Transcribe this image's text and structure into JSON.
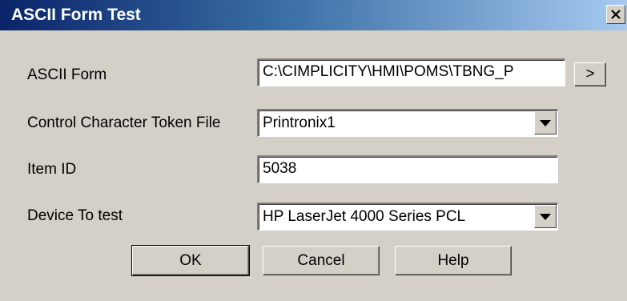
{
  "window": {
    "title": "ASCII Form Test"
  },
  "form": {
    "ascii_form": {
      "label": "ASCII Form",
      "value": "C:\\CIMPLICITY\\HMI\\POMS\\TBNG_P",
      "browse_label": ">"
    },
    "token_file": {
      "label": "Control Character Token File",
      "value": "Printronix1"
    },
    "item_id": {
      "label": "Item ID",
      "value": "5038"
    },
    "device": {
      "label": "Device To test",
      "value": "HP LaserJet 4000 Series PCL"
    }
  },
  "buttons": {
    "ok": "OK",
    "cancel": "Cancel",
    "help": "Help"
  },
  "icons": {
    "close": "close-icon",
    "dropdown": "chevron-down-icon"
  }
}
